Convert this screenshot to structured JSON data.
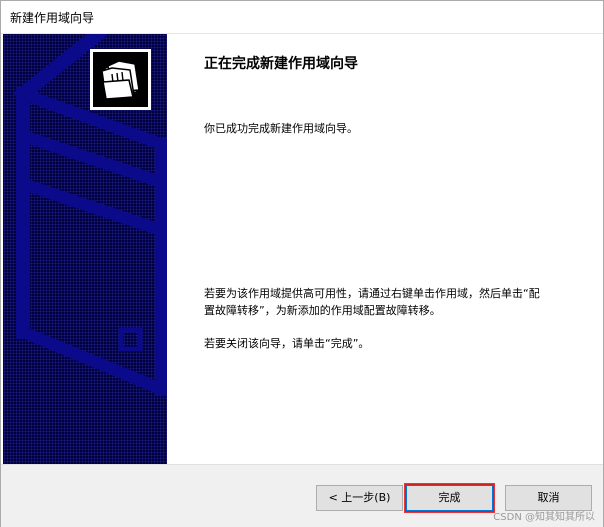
{
  "window": {
    "title": "新建作用域向导"
  },
  "banner": {
    "icon": "folders-icon",
    "colors": {
      "background": "#000040",
      "stripes": "#0a0a8a"
    }
  },
  "content": {
    "heading": "正在完成新建作用域向导",
    "paragraph1": "你已成功完成新建作用域向导。",
    "paragraph2": "若要为该作用域提供高可用性，请通过右键单击作用域，然后单击“配置故障转移”，为新添加的作用域配置故障转移。",
    "paragraph3": "若要关闭该向导，请单击“完成”。"
  },
  "footer": {
    "back_label": "< 上一步(B)",
    "finish_label": "完成",
    "cancel_label": "取消"
  },
  "watermark": "CSDN @知其知其所以"
}
